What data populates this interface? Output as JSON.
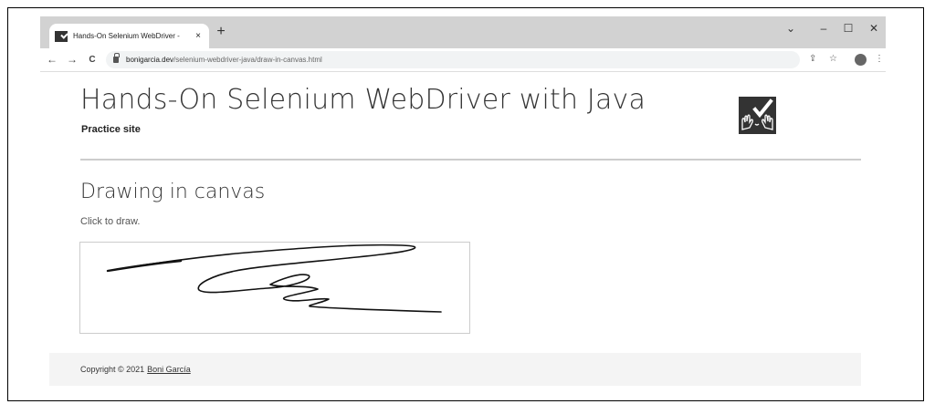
{
  "browser": {
    "tab_title": "Hands-On Selenium WebDriver -",
    "tab_close": "×",
    "new_tab": "+",
    "url_host": "bonigarcia.dev",
    "url_path": "/selenium-webdriver-java/draw-in-canvas.html",
    "window_controls": [
      "⌄",
      "–",
      "☐",
      "✕"
    ],
    "nav": {
      "back": "←",
      "forward": "→",
      "reload": "C"
    },
    "toolbar_icons": {
      "share": "⇪",
      "bookmark": "☆",
      "menu": "⋮"
    }
  },
  "page": {
    "site_title": "Hands-On Selenium WebDriver with Java",
    "site_subtitle": "Practice site",
    "section_title": "Drawing in canvas",
    "hint": "Click to draw.",
    "footer_text": "Copyright © 2021",
    "footer_link": "Boni García"
  },
  "icons": {
    "favicon": "selenium-logo-icon",
    "logo": "hands-checkmark-logo"
  },
  "colors": {
    "tabstrip": "#d2d2d2",
    "logo_bg": "#333333"
  }
}
